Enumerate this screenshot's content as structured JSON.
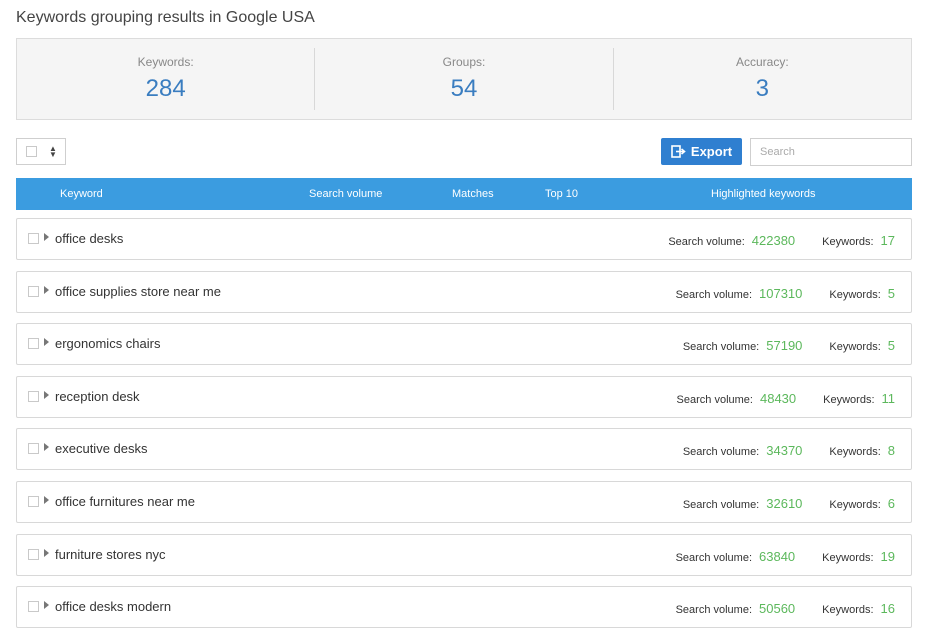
{
  "page": {
    "title": "Keywords grouping results in Google USA"
  },
  "stats": [
    {
      "label": "Keywords:",
      "value": "284"
    },
    {
      "label": "Groups:",
      "value": "54"
    },
    {
      "label": "Accuracy:",
      "value": "3"
    }
  ],
  "toolbar": {
    "export_label": "Export",
    "search_placeholder": "Search"
  },
  "table": {
    "columns": [
      "Keyword",
      "Search volume",
      "Matches",
      "Top 10",
      "Highlighted keywords"
    ],
    "metric_labels": {
      "volume": "Search volume:",
      "keywords": "Keywords:"
    },
    "rows": [
      {
        "keyword": "office desks",
        "search_volume": "422380",
        "keywords": "17"
      },
      {
        "keyword": "office supplies store near me",
        "search_volume": "107310",
        "keywords": "5"
      },
      {
        "keyword": "ergonomics chairs",
        "search_volume": "57190",
        "keywords": "5"
      },
      {
        "keyword": "reception desk",
        "search_volume": "48430",
        "keywords": "11"
      },
      {
        "keyword": "executive desks",
        "search_volume": "34370",
        "keywords": "8"
      },
      {
        "keyword": "office furnitures near me",
        "search_volume": "32610",
        "keywords": "6"
      },
      {
        "keyword": "furniture stores nyc",
        "search_volume": "63840",
        "keywords": "19"
      },
      {
        "keyword": "office desks modern",
        "search_volume": "50560",
        "keywords": "16"
      }
    ]
  },
  "colors": {
    "accent": "#2f7fd0",
    "header": "#3b9ce0",
    "stat_value": "#3a7dc0",
    "metric_value": "#5cb85c"
  }
}
